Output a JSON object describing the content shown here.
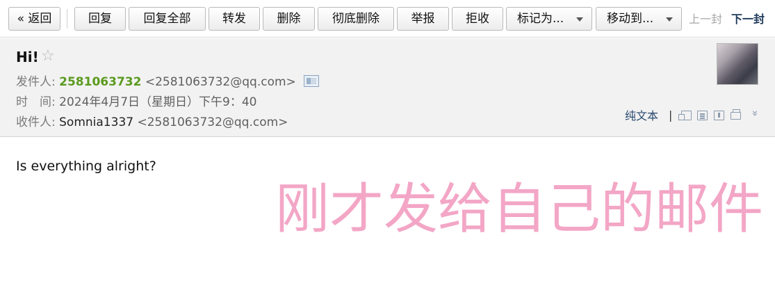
{
  "toolbar": {
    "back_label": "« 返回",
    "reply_label": "回复",
    "reply_all_label": "回复全部",
    "forward_label": "转发",
    "delete_label": "删除",
    "delete_permanently_label": "彻底删除",
    "report_label": "举报",
    "reject_label": "拒收",
    "mark_as_label": "标记为...",
    "move_to_label": "移动到...",
    "prev_label": "上一封",
    "next_label": "下一封"
  },
  "mail": {
    "subject": "Hi!",
    "star_glyph": "☆",
    "sender_label": "发件人:",
    "sender_name": "2581063732",
    "sender_email": "<2581063732@qq.com>",
    "time_label": "时　间:",
    "time_value": "2024年4月7日（星期日）下午9：40",
    "recipient_label": "收件人:",
    "recipient_name": "Somnia1337",
    "recipient_email": "<2581063732@qq.com>",
    "body": "Is everything alright?"
  },
  "tools": {
    "plain_text_label": "纯文本",
    "separator": "|",
    "expand_glyph": "»",
    "icons": [
      "new-window-icon",
      "notes-icon",
      "download-icon",
      "print-icon"
    ]
  },
  "overlay_caption": "刚才发给自己的邮件",
  "colors": {
    "sender_name": "#5a9a1e",
    "caption": "#f3a6c6",
    "link": "#2a4a70",
    "header_bg": "#f2f2f2"
  }
}
